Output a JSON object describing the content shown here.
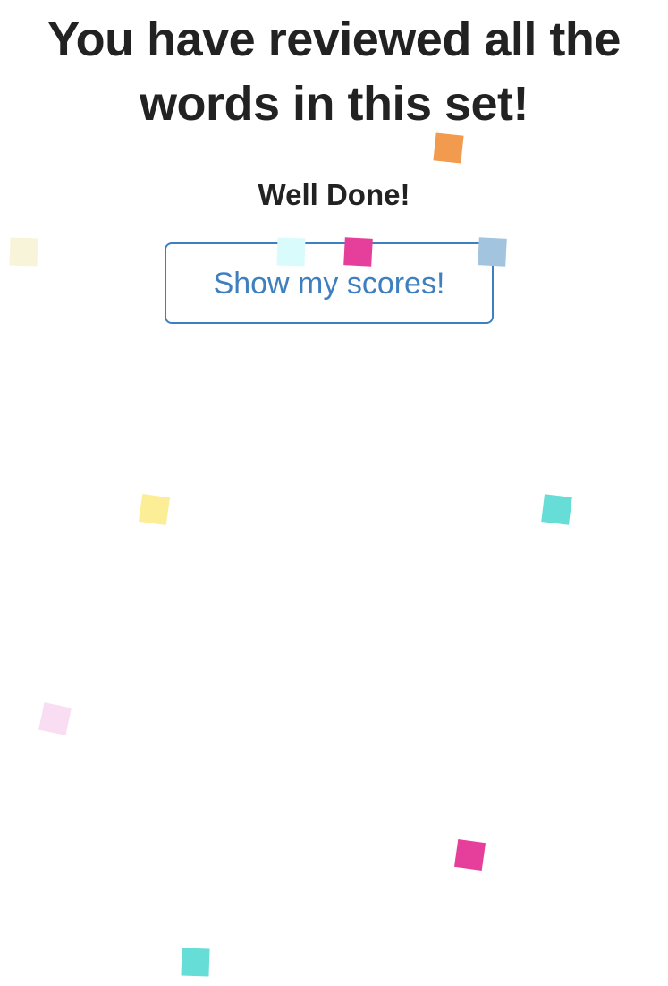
{
  "completion": {
    "title": "You have reviewed all the words in this set!",
    "message": "Well Done!",
    "button_label": "Show my scores!"
  },
  "confetti_colors": {
    "orange": "#f29a4d",
    "cream": "#f8f4d9",
    "light_cyan": "#d9fbfc",
    "magenta": "#e63f9b",
    "steel_blue": "#a3c4de",
    "yellow": "#fbee96",
    "turquoise": "#66ddd7",
    "pink": "#f9ddf2"
  }
}
